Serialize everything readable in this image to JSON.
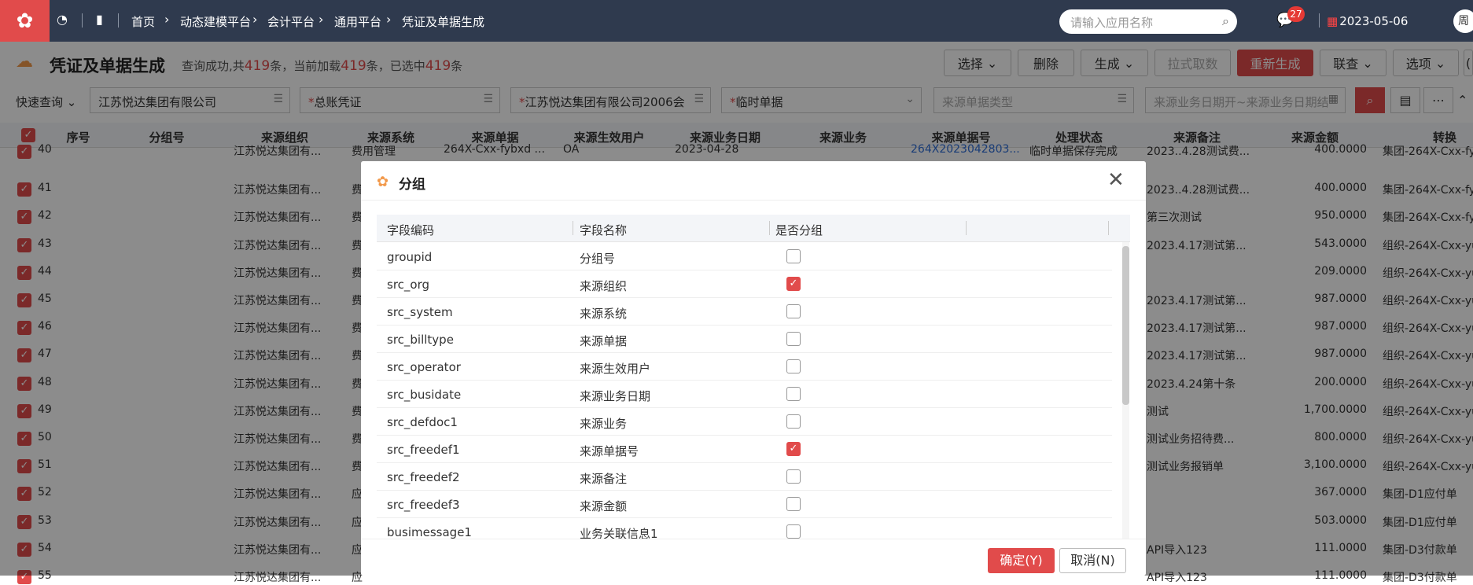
{
  "topbar": {
    "breadcrumbs": [
      "首页",
      "动态建模平台",
      "会计平台",
      "通用平台",
      "凭证及单据生成"
    ],
    "search_placeholder": "请输入应用名称",
    "notification_count": "27",
    "date": "2023-05-06",
    "user": "周"
  },
  "page": {
    "title": "凭证及单据生成",
    "summary_prefix": "查询成功,共",
    "total": "419",
    "summary_mid1": "条，当前加载",
    "loaded": "419",
    "summary_mid2": "条，已选中",
    "selected": "419",
    "summary_suffix": "条"
  },
  "toolbar": {
    "select": "选择",
    "delete": "删除",
    "generate": "生成",
    "pull": "拉式取数",
    "regenerate": "重新生成",
    "linked": "联查",
    "options": "选项"
  },
  "filters": {
    "quick_query": "快速查询",
    "org": "江苏悦达集团有限公司",
    "ledger": "总账凭证",
    "account_book": "江苏悦达集团有限公司2006会",
    "temp_bill": "临时单据",
    "source_type_placeholder": "来源单据类型",
    "date_range_placeholder": "来源业务日期开~来源业务日期结"
  },
  "grid": {
    "columns": [
      "序号",
      "分组号",
      "来源组织",
      "来源系统",
      "来源单据",
      "来源生效用户",
      "来源业务日期",
      "来源业务",
      "来源单据号",
      "处理状态",
      "来源备注",
      "来源金额",
      "转换"
    ],
    "rows": [
      {
        "no": "40",
        "org": "江苏悦达集团有...",
        "sys": "费用管理",
        "bill": "264X-Cxx-fybxd ...",
        "user": "OA",
        "date": "2023-04-28",
        "billno": "264X2023042803...",
        "status": "临时单据保存完成",
        "remark": "2023..4.28测试费...",
        "amount": "400.0000",
        "conv": "集团-264X-Cxx-fy"
      },
      {
        "no": "41",
        "org": "江苏悦达集团有...",
        "sys": "费",
        "remark": "2023..4.28测试费...",
        "amount": "400.0000",
        "conv": "集团-264X-Cxx-fy"
      },
      {
        "no": "42",
        "org": "江苏悦达集团有...",
        "sys": "费",
        "remark": "第三次测试",
        "amount": "950.0000",
        "conv": "集团-264X-Cxx-fy"
      },
      {
        "no": "43",
        "org": "江苏悦达集团有...",
        "sys": "费",
        "remark": "2023.4.17测试第...",
        "amount": "543.0000",
        "conv": "组织-264X-Cxx-yu"
      },
      {
        "no": "44",
        "org": "江苏悦达集团有...",
        "sys": "费",
        "remark": "",
        "amount": "209.0000",
        "conv": "组织-264X-Cxx-yu"
      },
      {
        "no": "45",
        "org": "江苏悦达集团有...",
        "sys": "费",
        "remark": "2023.4.17测试第...",
        "amount": "987.0000",
        "conv": "组织-264X-Cxx-yu"
      },
      {
        "no": "46",
        "org": "江苏悦达集团有...",
        "sys": "费",
        "remark": "2023.4.17测试第...",
        "amount": "987.0000",
        "conv": "组织-264X-Cxx-yu"
      },
      {
        "no": "47",
        "org": "江苏悦达集团有...",
        "sys": "费",
        "remark": "2023.4.17测试第...",
        "amount": "987.0000",
        "conv": "组织-264X-Cxx-yu"
      },
      {
        "no": "48",
        "org": "江苏悦达集团有...",
        "sys": "费",
        "remark": "2023.4.24第十条",
        "amount": "200.0000",
        "conv": "组织-264X-Cxx-yu"
      },
      {
        "no": "49",
        "org": "江苏悦达集团有...",
        "sys": "费",
        "remark": "测试",
        "amount": "1,700.0000",
        "conv": "组织-264X-Cxx-yu"
      },
      {
        "no": "50",
        "org": "江苏悦达集团有...",
        "sys": "费",
        "remark": "测试业务招待费...",
        "amount": "800.0000",
        "conv": "组织-264X-Cxx-yu"
      },
      {
        "no": "51",
        "org": "江苏悦达集团有...",
        "sys": "费",
        "remark": "测试业务报销单",
        "amount": "3,100.0000",
        "conv": "组织-264X-Cxx-yu"
      },
      {
        "no": "52",
        "org": "江苏悦达集团有...",
        "sys": "应",
        "remark": "",
        "amount": "367.0000",
        "conv": "集团-D1应付单"
      },
      {
        "no": "53",
        "org": "江苏悦达集团有...",
        "sys": "应",
        "remark": "",
        "amount": "503.0000",
        "conv": "集团-D1应付单"
      },
      {
        "no": "54",
        "org": "江苏悦达集团有...",
        "sys": "应",
        "remark": "API导入123",
        "amount": "111.0000",
        "conv": "集团-D3付款单"
      },
      {
        "no": "55",
        "org": "江苏悦达集团有...",
        "sys": "应",
        "remark": "API导入123",
        "amount": "111.0000",
        "conv": "集团-D3付款单"
      }
    ]
  },
  "dialog": {
    "title": "分组",
    "col_code": "字段编码",
    "col_name": "字段名称",
    "col_group": "是否分组",
    "rows": [
      {
        "code": "groupid",
        "name": "分组号",
        "checked": false
      },
      {
        "code": "src_org",
        "name": "来源组织",
        "checked": true
      },
      {
        "code": "src_system",
        "name": "来源系统",
        "checked": false
      },
      {
        "code": "src_billtype",
        "name": "来源单据",
        "checked": false
      },
      {
        "code": "src_operator",
        "name": "来源生效用户",
        "checked": false
      },
      {
        "code": "src_busidate",
        "name": "来源业务日期",
        "checked": false
      },
      {
        "code": "src_defdoc1",
        "name": "来源业务",
        "checked": false
      },
      {
        "code": "src_freedef1",
        "name": "来源单据号",
        "checked": true
      },
      {
        "code": "src_freedef2",
        "name": "来源备注",
        "checked": false
      },
      {
        "code": "src_freedef3",
        "name": "来源金额",
        "checked": false
      },
      {
        "code": "busimessage1",
        "name": "业务关联信息1",
        "checked": false
      }
    ],
    "ok": "确定(Y)",
    "cancel": "取消(N)"
  },
  "colors": {
    "brand": "#e14b4b",
    "topbar": "#2f3a4e",
    "link": "#2f6ed8"
  }
}
